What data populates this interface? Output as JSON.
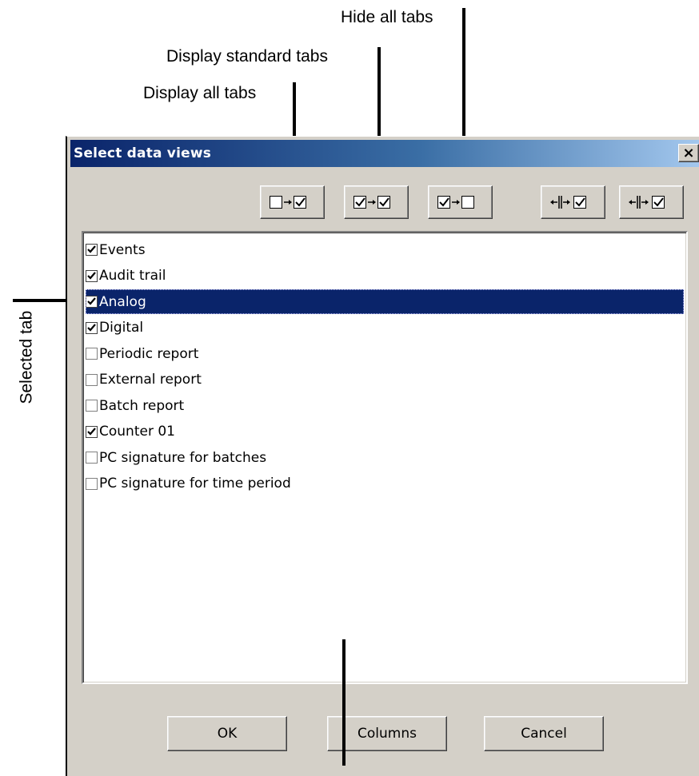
{
  "annotations": {
    "hide_all": "Hide all tabs",
    "display_standard": "Display standard tabs",
    "display_all": "Display all tabs",
    "selected_tab": "Selected tab"
  },
  "dialog": {
    "title": "Select data views",
    "close_symbol": "×",
    "toolbar_icons": [
      "display-all-tabs-icon",
      "display-standard-tabs-icon",
      "hide-all-tabs-icon",
      "column-show-icon",
      "column-hide-icon"
    ],
    "items": [
      {
        "label": "Events",
        "checked": true
      },
      {
        "label": "Audit trail",
        "checked": true
      },
      {
        "label": "Analog",
        "checked": true,
        "selected": true
      },
      {
        "label": "Digital",
        "checked": true
      },
      {
        "label": "Periodic report",
        "checked": false
      },
      {
        "label": "External report",
        "checked": false
      },
      {
        "label": "Batch report",
        "checked": false
      },
      {
        "label": "Counter 01",
        "checked": true
      },
      {
        "label": "PC signature for batches",
        "checked": false
      },
      {
        "label": "PC signature for time period",
        "checked": false
      }
    ],
    "buttons": {
      "ok": "OK",
      "columns": "Columns",
      "cancel": "Cancel"
    },
    "colors": {
      "selection": "#0a246a",
      "face": "#d4d0c8",
      "title_start": "#0a246a",
      "title_end": "#a6caf0"
    }
  }
}
